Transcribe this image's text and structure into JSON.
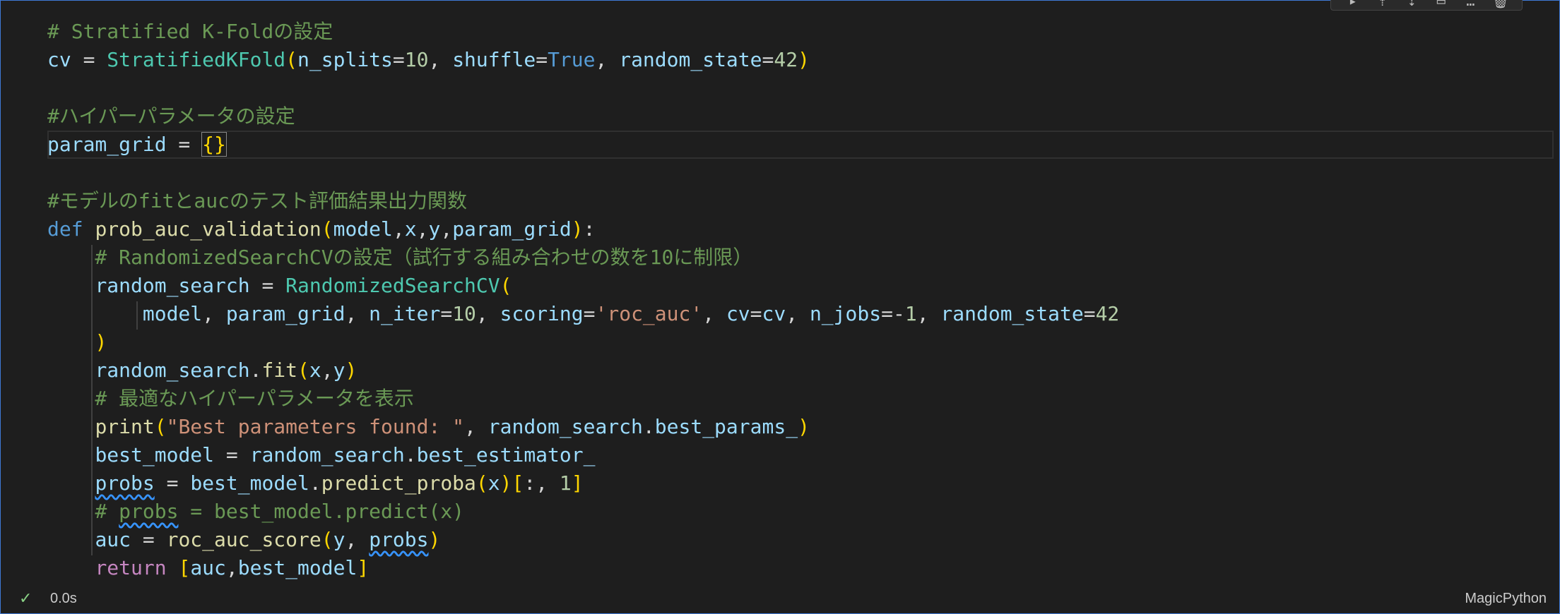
{
  "cell": {
    "lines": [
      "# Stratified K-Foldの設定",
      "cv = StratifiedKFold(n_splits=10, shuffle=True, random_state=42)",
      "",
      "#ハイパーパラメータの設定",
      "param_grid = {}",
      "",
      "#モデルのfitとaucのテスト評価結果出力関数",
      "def prob_auc_validation(model,x,y,param_grid):",
      "    # RandomizedSearchCVの設定（試行する組み合わせの数を10に制限）",
      "    random_search = RandomizedSearchCV(",
      "        model, param_grid, n_iter=10, scoring='roc_auc', cv=cv, n_jobs=-1, random_state=42",
      "    )",
      "    random_search.fit(x,y)",
      "    # 最適なハイパーパラメータを表示",
      "    print(\"Best parameters found: \", random_search.best_params_)",
      "    best_model = random_search.best_estimator_",
      "    probs = best_model.predict_proba(x)[:, 1]",
      "    # probs = best_model.predict(x)",
      "    auc = roc_auc_score(y, probs)",
      "    return [auc,best_model]"
    ]
  },
  "status": {
    "check_icon": "check-icon",
    "exec_time": "0.0s",
    "language": "MagicPython"
  },
  "toolbar": {
    "icons": [
      "run-by-line-icon",
      "execute-above-icon",
      "execute-below-icon",
      "split-cell-icon",
      "more-icon",
      "delete-icon"
    ]
  }
}
